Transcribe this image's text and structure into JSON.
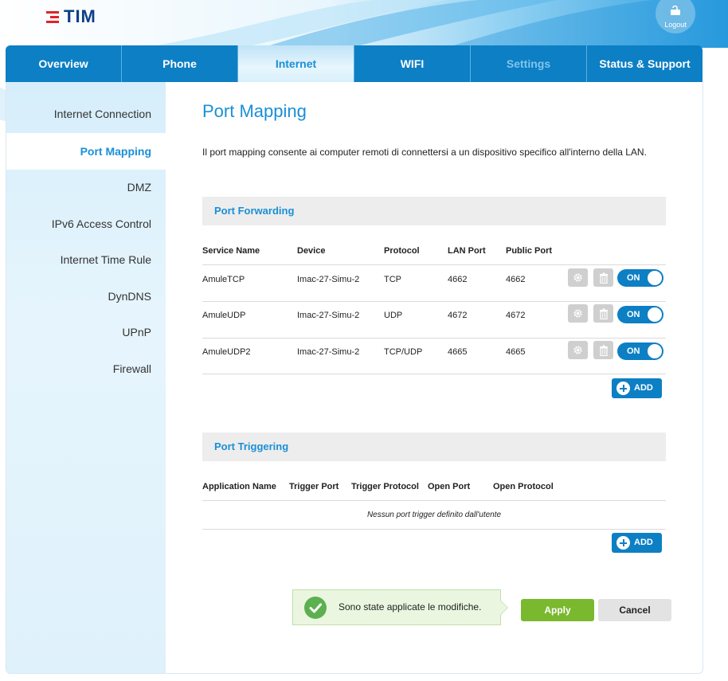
{
  "brand": {
    "logo_text": "TIM",
    "accent": "#0d7fc4",
    "title_color": "#1a8fd6"
  },
  "header": {
    "logout_label": "Logout"
  },
  "nav": {
    "tabs": [
      {
        "label": "Overview"
      },
      {
        "label": "Phone"
      },
      {
        "label": "Internet",
        "active": true
      },
      {
        "label": "WIFI"
      },
      {
        "label": "Settings"
      },
      {
        "label": "Status & Support"
      }
    ]
  },
  "sidebar": {
    "items": [
      {
        "label": "Internet Connection"
      },
      {
        "label": "Port Mapping",
        "active": true
      },
      {
        "label": "DMZ"
      },
      {
        "label": "IPv6 Access Control"
      },
      {
        "label": "Internet Time Rule"
      },
      {
        "label": "DynDNS"
      },
      {
        "label": "UPnP"
      },
      {
        "label": "Firewall"
      }
    ]
  },
  "main": {
    "title": "Port Mapping",
    "intro": "Il port mapping consente ai computer remoti di connettersi a un dispositivo specifico all'interno della LAN.",
    "port_forwarding": {
      "heading": "Port Forwarding",
      "columns": [
        "Service Name",
        "Device",
        "Protocol",
        "LAN Port",
        "Public Port"
      ],
      "rows": [
        {
          "service": "AmuleTCP",
          "device": "Imac-27-Simu-2",
          "protocol": "TCP",
          "lan_port": "4662",
          "public_port": "4662",
          "toggle": "ON"
        },
        {
          "service": "AmuleUDP",
          "device": "Imac-27-Simu-2",
          "protocol": "UDP",
          "lan_port": "4672",
          "public_port": "4672",
          "toggle": "ON"
        },
        {
          "service": "AmuleUDP2",
          "device": "Imac-27-Simu-2",
          "protocol": "TCP/UDP",
          "lan_port": "4665",
          "public_port": "4665",
          "toggle": "ON"
        }
      ],
      "add_label": "ADD"
    },
    "port_triggering": {
      "heading": "Port Triggering",
      "columns": [
        "Application Name",
        "Trigger Port",
        "Trigger Protocol",
        "Open Port",
        "Open Protocol"
      ],
      "empty_message": "Nessun port trigger definito dall'utente",
      "add_label": "ADD"
    },
    "toast": {
      "message": "Sono state applicate le modifiche."
    },
    "apply_label": "Apply",
    "cancel_label": "Cancel"
  }
}
